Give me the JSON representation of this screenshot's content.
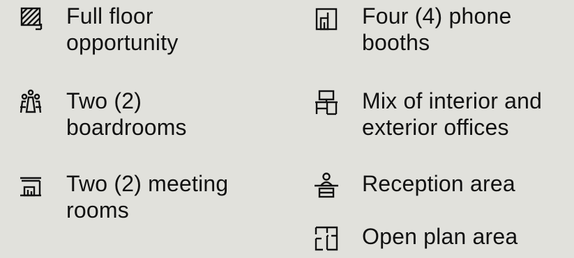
{
  "features": [
    {
      "icon": "full-floor-icon",
      "lines": [
        "Full floor",
        "opportunity"
      ]
    },
    {
      "icon": "boardroom-icon",
      "lines": [
        "Two (2)",
        "boardrooms"
      ]
    },
    {
      "icon": "meeting-room-icon",
      "lines": [
        "Two (2) meeting",
        "rooms"
      ]
    },
    {
      "icon": "phone-booth-icon",
      "lines": [
        "Four (4) phone",
        "booths"
      ]
    },
    {
      "icon": "office-desk-icon",
      "lines": [
        "Mix of interior and",
        "exterior offices"
      ]
    },
    {
      "icon": "reception-icon",
      "lines": [
        "Reception area"
      ]
    },
    {
      "icon": "floor-plan-icon",
      "lines": [
        "Open plan area"
      ]
    }
  ]
}
